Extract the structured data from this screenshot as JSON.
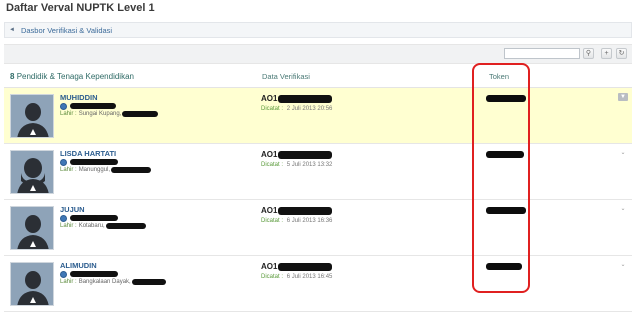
{
  "page": {
    "title": "Daftar Verval NUPTK Level 1"
  },
  "breadcrumb": {
    "link_label": "Dasbor Verifikasi & Validasi"
  },
  "toolbar": {
    "search_placeholder": "",
    "search_button_icon": "search-icon",
    "add_button_icon": "plus-icon",
    "refresh_button_icon": "refresh-icon"
  },
  "table": {
    "count": "8",
    "count_label": "Pendidik & Tenaga Kependidikan",
    "col_verification": "Data Verifikasi",
    "col_token": "Token"
  },
  "rows": [
    {
      "name": "MUHIDDIN",
      "birth_label": "Lahir :",
      "birth_place": "Sungai Kupang,",
      "code_prefix": "AO1",
      "recorded_label": "Dicatat :",
      "recorded_date": "2 Juli 2013 20:56"
    },
    {
      "name": "LISDA HARTATI",
      "birth_label": "Lahir :",
      "birth_place": "Manunggul,",
      "code_prefix": "AO1",
      "recorded_label": "Dicatat :",
      "recorded_date": "5 Juli 2013 13:32"
    },
    {
      "name": "JUJUN",
      "birth_label": "Lahir :",
      "birth_place": "Kotabaru,",
      "code_prefix": "AO1",
      "recorded_label": "Dicatat :",
      "recorded_date": "6 Juli 2013 16:36"
    },
    {
      "name": "ALIMUDIN",
      "birth_label": "Lahir :",
      "birth_place": "Bangkalaan Dayak,",
      "code_prefix": "AO1",
      "recorded_label": "Dicatat :",
      "recorded_date": "6 Juli 2013 16:45"
    }
  ],
  "colors": {
    "highlight_row": "#ffffd1",
    "name_link": "#2c5d8f",
    "annotation": "#e02020"
  }
}
